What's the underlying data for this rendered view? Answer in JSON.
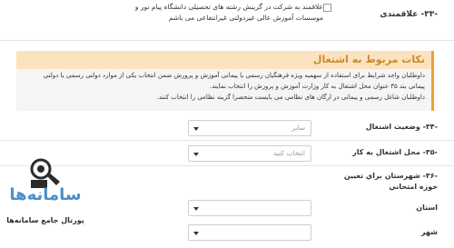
{
  "row33": {
    "label": "-۳۳- علاقمندی",
    "text": "علاقمند به شرکت در گزینش رشته های تحصیلی دانشگاه پیام نور و موسسات آموزش عالی غیردولتی غیرانتفاعی می باشم"
  },
  "notice": {
    "title": "نکات مربوط به اشتغال",
    "lines": [
      "داوطلبان واجد شرایط برای استفاده از سهمیه ویژه فرهنگیان رسمی یا پیمانی آموزش و پرورش ضمن انتخاب یکی از موارد دولتی رسمی یا دولتی",
      "پیمانی بند ۳۵ عنوان محل اشتغال به کار وزارت آموزش و پرورش را انتخاب نمایند.",
      "داوطلبان شاغل رسمی و پیمانی در ارگان های نظامی می بایست منحصرا گزینه نظامی را انتخاب کنند."
    ]
  },
  "fields": {
    "employment_status": {
      "label": "-۳۴- وضعیت اشتغال",
      "value": "سایر"
    },
    "workplace": {
      "label": "-۳۵- محل اشتغال به کار",
      "value": "انتخاب کنید"
    },
    "exam_city_heading": {
      "label": "-۳۶- شهرستان براي تعيين حوزه امتحاني"
    },
    "province": {
      "label": "استان",
      "value": ""
    },
    "city": {
      "label": "شهر",
      "value": ""
    }
  },
  "logo": {
    "icon": "bird-with-laptop-icon",
    "brand": "سامانه‌ها",
    "tagline": "پورتال جامع سامانه‌ها"
  },
  "colors": {
    "accent": "#e9a23b",
    "notice_header_bg": "#fbe3bf",
    "notice_title": "#c98b2f",
    "brand_blue": "#4a8fcc"
  }
}
